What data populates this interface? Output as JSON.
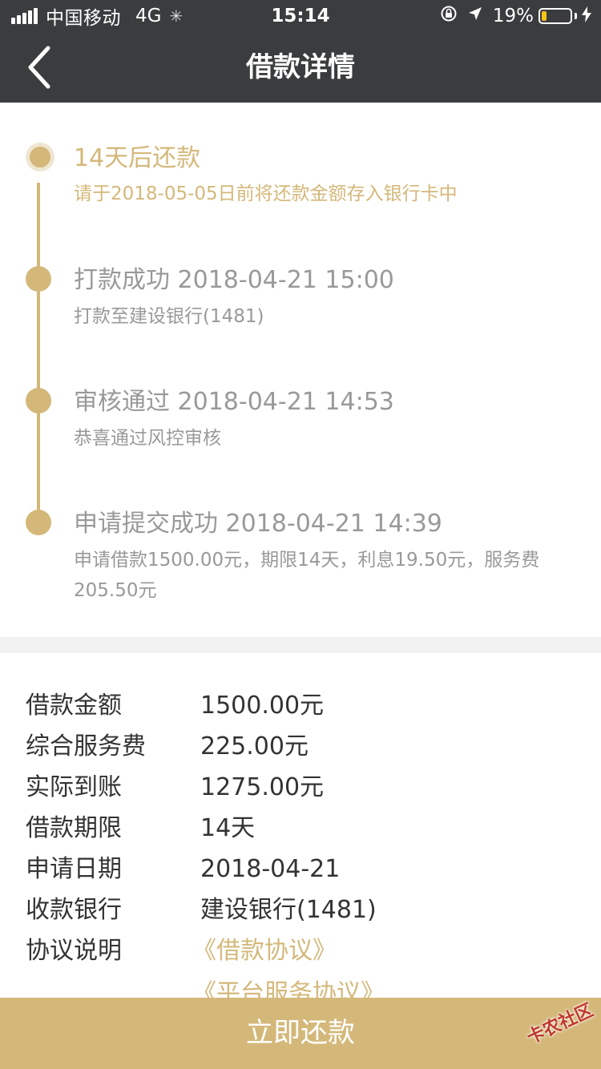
{
  "status_bar": {
    "carrier": "中国移动",
    "network": "4G",
    "time": "15:14",
    "battery_percent": "19%",
    "battery_level": 0.19
  },
  "nav": {
    "title": "借款详情",
    "back_icon": "chevron-left-icon"
  },
  "timeline": [
    {
      "title": "14天后还款",
      "subtitle": "请于2018-05-05日前将还款金额存入银行卡中",
      "active": true
    },
    {
      "title": "打款成功 2018-04-21 15:00",
      "subtitle": "打款至建设银行(1481)",
      "active": false
    },
    {
      "title": "审核通过 2018-04-21 14:53",
      "subtitle": "恭喜通过风控审核",
      "active": false
    },
    {
      "title": "申请提交成功 2018-04-21 14:39",
      "subtitle": "申请借款1500.00元，期限14天，利息19.50元，服务费205.50元",
      "active": false
    }
  ],
  "details": [
    {
      "label": "借款金额",
      "value": "1500.00元"
    },
    {
      "label": "综合服务费",
      "value": "225.00元"
    },
    {
      "label": "实际到账",
      "value": "1275.00元"
    },
    {
      "label": "借款期限",
      "value": "14天"
    },
    {
      "label": "申请日期",
      "value": "2018-04-21"
    },
    {
      "label": "收款银行",
      "value": "建设银行(1481)"
    }
  ],
  "agreement": {
    "label": "协议说明",
    "links": [
      "《借款协议》",
      "《平台服务协议》"
    ]
  },
  "repay_button": "立即还款",
  "watermark": "卡农社区",
  "colors": {
    "header_bg": "#3a3c3e",
    "accent": "#d4b87a",
    "text_gray": "#999999",
    "text_dark": "#333333"
  }
}
